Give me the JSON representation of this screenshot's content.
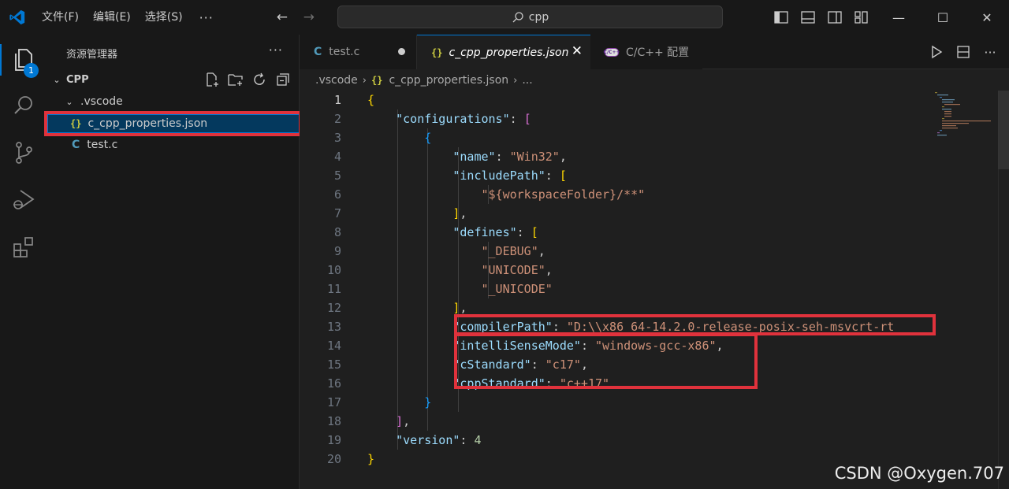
{
  "titlebar": {
    "menu": [
      "文件(F)",
      "编辑(E)",
      "选择(S)"
    ],
    "more": "···",
    "search": "cpp"
  },
  "activitybar": {
    "explorer_badge": "1",
    "icons": [
      "files-icon",
      "search-icon",
      "source-control-icon",
      "run-debug-icon",
      "extensions-icon"
    ]
  },
  "sidebar": {
    "title": "资源管理器",
    "more": "···",
    "root": "CPP",
    "folder": ".vscode",
    "files": [
      {
        "name": "c_cpp_properties.json",
        "icon": "{}"
      },
      {
        "name": "test.c",
        "icon": "C"
      }
    ]
  },
  "tabs": [
    {
      "label": "test.c",
      "icon": "C"
    },
    {
      "label": "c_cpp_properties.json",
      "icon": "{}"
    },
    {
      "label": "C/C++ 配置",
      "icon": "C/C++"
    }
  ],
  "breadcrumb": {
    "folder": ".vscode",
    "file": "c_cpp_properties.json",
    "tail": "..."
  },
  "editor": {
    "line_numbers": [
      "1",
      "2",
      "3",
      "4",
      "5",
      "6",
      "7",
      "8",
      "9",
      "10",
      "11",
      "12",
      "13",
      "14",
      "15",
      "16",
      "17",
      "18",
      "19",
      "20"
    ],
    "current_line": "1",
    "keys": {
      "configurations": "\"configurations\"",
      "name": "\"name\"",
      "includePath": "\"includePath\"",
      "defines": "\"defines\"",
      "compilerPath": "\"compilerPath\"",
      "intelliSenseMode": "\"intelliSenseMode\"",
      "cStandard": "\"cStandard\"",
      "cppStandard": "\"cppStandard\"",
      "version": "\"version\""
    },
    "values": {
      "name": "\"Win32\"",
      "includePath_0": "\"${workspaceFolder}/**\"",
      "define_0": "\"_DEBUG\"",
      "define_1": "\"UNICODE\"",
      "define_2": "\"_UNICODE\"",
      "compilerPath": "\"D:\\\\x86_64-14.2.0-release-posix-seh-msvcrt-rt",
      "intelliSenseMode": "\"windows-gcc-x86\"",
      "cStandard": "\"c17\"",
      "cppStandard": "\"c++17\"",
      "version": "4"
    }
  },
  "watermark": "CSDN @Oxygen.707",
  "colors": {
    "accent": "#0078d4",
    "highlight_box": "#e0323c",
    "key": "#9cdcfe",
    "string": "#ce9178",
    "number": "#b5cea8"
  }
}
